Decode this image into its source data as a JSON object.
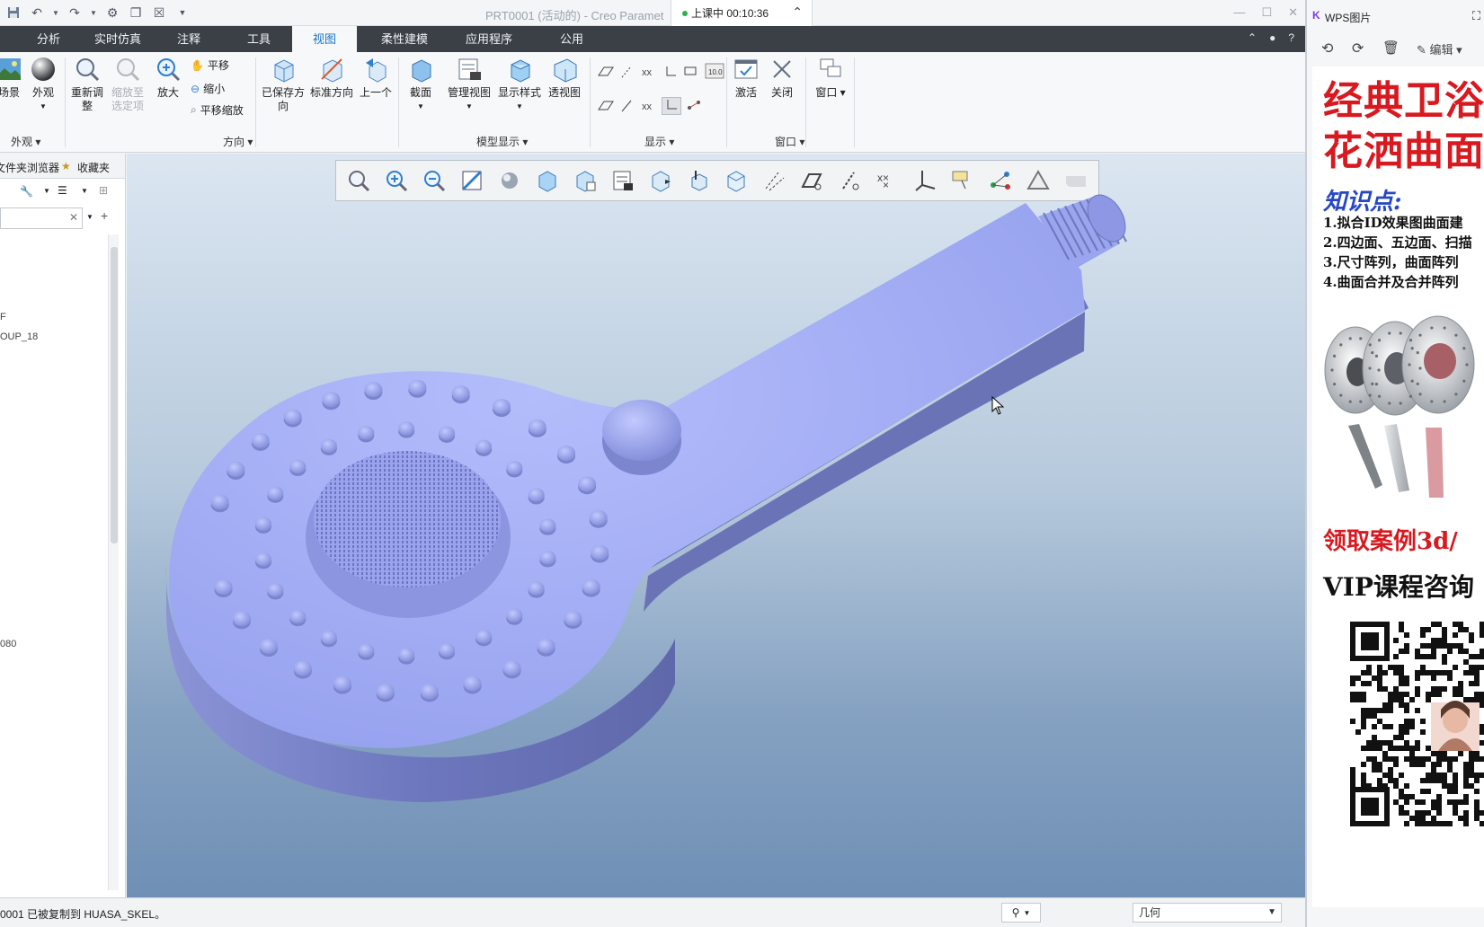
{
  "creo": {
    "title": "PRT0001 (活动的) - Creo Paramet",
    "timer": "上课中 00:10:36",
    "tabs": [
      {
        "label": "分析"
      },
      {
        "label": "实时仿真"
      },
      {
        "label": "注释"
      },
      {
        "label": "工具"
      },
      {
        "label": "视图",
        "active": true
      },
      {
        "label": "柔性建模"
      },
      {
        "label": "应用程序"
      },
      {
        "label": "公用"
      }
    ],
    "ribbon": {
      "scene_label": "场景",
      "appearance_label": "外观",
      "appearance_group": "外观",
      "refit_label": "重新调整",
      "zoom_selected_label": "缩放至选定项",
      "zoom_in_label": "放大",
      "pan_label": "平移",
      "zoom_out_label": "缩小",
      "pan_zoom_label": "平移缩放",
      "saved_orient_label": "已保存方向",
      "std_orient_label": "标准方向",
      "prev_label": "上一个",
      "orientation_group": "方向",
      "section_label": "截面",
      "manage_views_label": "管理视图",
      "display_style_label": "显示样式",
      "perspective_label": "透视图",
      "model_display_group": "模型显示",
      "show_group": "显示",
      "activate_label": "激活",
      "close_label": "关闭",
      "window_label": "窗口",
      "window_group": "窗口"
    },
    "left_panel": {
      "tab_browser": "文件夹浏览器",
      "tab_favorites": "收藏夹",
      "tree_items": [
        {
          "text": "F"
        },
        {
          "text": "OUP_18"
        },
        {
          "text": "080"
        }
      ]
    },
    "status": {
      "message": "0001 已被复制到 HUASA_SKEL。",
      "filter_value": "几何"
    }
  },
  "wps": {
    "app_title": "WPS图片",
    "edit_label": "编辑",
    "poster": {
      "title_line1": "经典卫浴",
      "title_line2": "花洒曲面",
      "knowledge_heading": "知识点:",
      "points": [
        "1.拟合ID效果图曲面建",
        "2.四边面、五边面、扫描",
        "3.尺寸阵列，曲面阵列",
        "4.曲面合并及合并阵列"
      ],
      "cta_case": "领取案例3d/",
      "cta_vip": "VIP课程咨询"
    }
  },
  "colors": {
    "accent_tab": "#1a73c6",
    "model_fill": "#9aa6f0",
    "poster_red": "#d8191f",
    "poster_blue": "#2747c6"
  }
}
